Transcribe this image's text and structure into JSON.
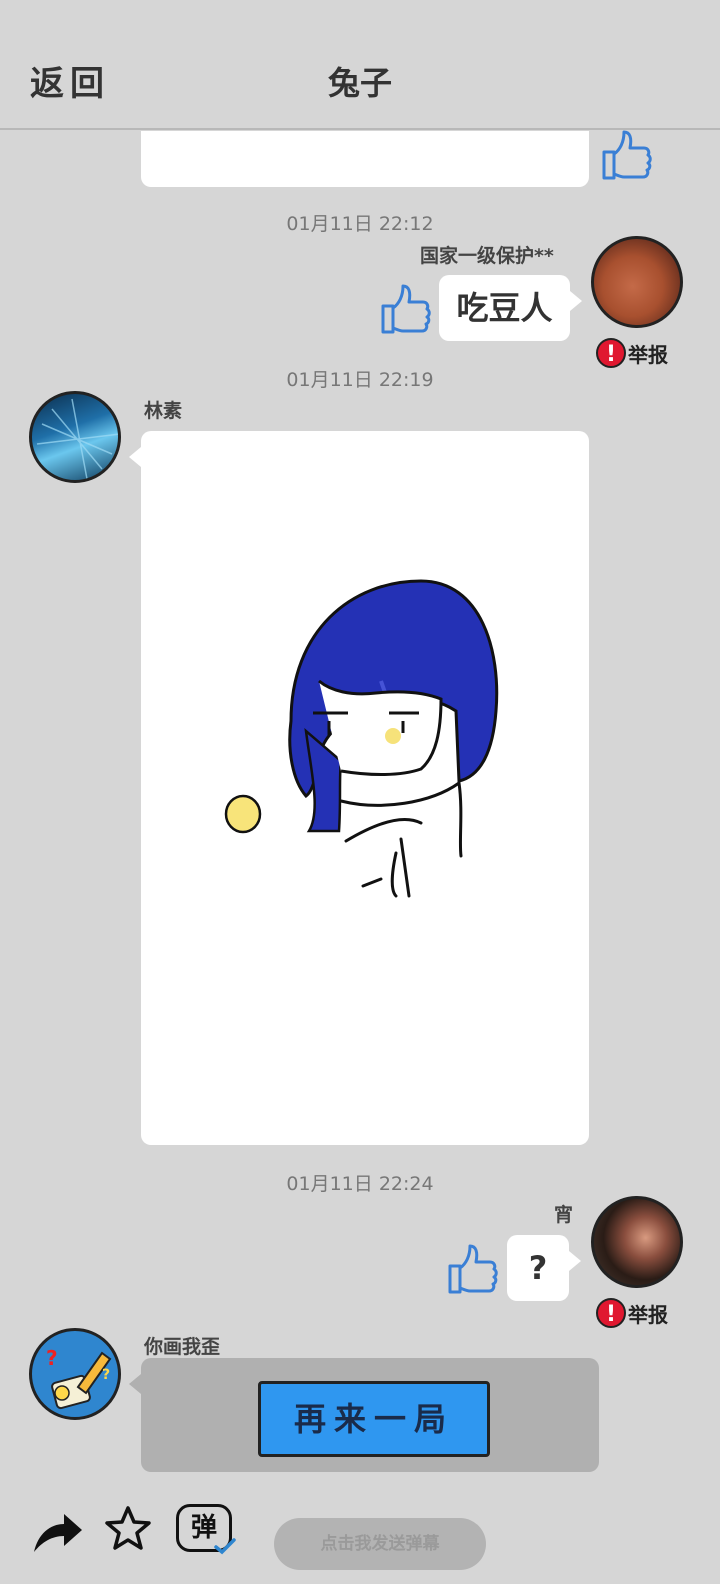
{
  "header": {
    "back_label": "返回",
    "title": "兔子"
  },
  "messages": [
    {
      "time": "01月11日 22:12",
      "name": "国家一级保护**",
      "text": "吃豆人",
      "report": "举报"
    },
    {
      "time": "01月11日 22:19",
      "name": "林素"
    },
    {
      "time": "01月11日 22:24",
      "name": "宵",
      "text": "?",
      "report": "举报"
    },
    {
      "name": "你画我歪",
      "game_button": "再来一局"
    }
  ],
  "bottom": {
    "danmaku_icon_text": "弹",
    "danmaku_placeholder": "点击我发送弹幕"
  },
  "colors": {
    "background": "#d6d6d6",
    "thumb": "#3a7fd5",
    "report": "#e01830",
    "game_button": "#2f97f0"
  },
  "icons": [
    "share-arrow-icon",
    "star-icon",
    "danmaku-icon",
    "thumbs-up-icon",
    "report-icon"
  ]
}
